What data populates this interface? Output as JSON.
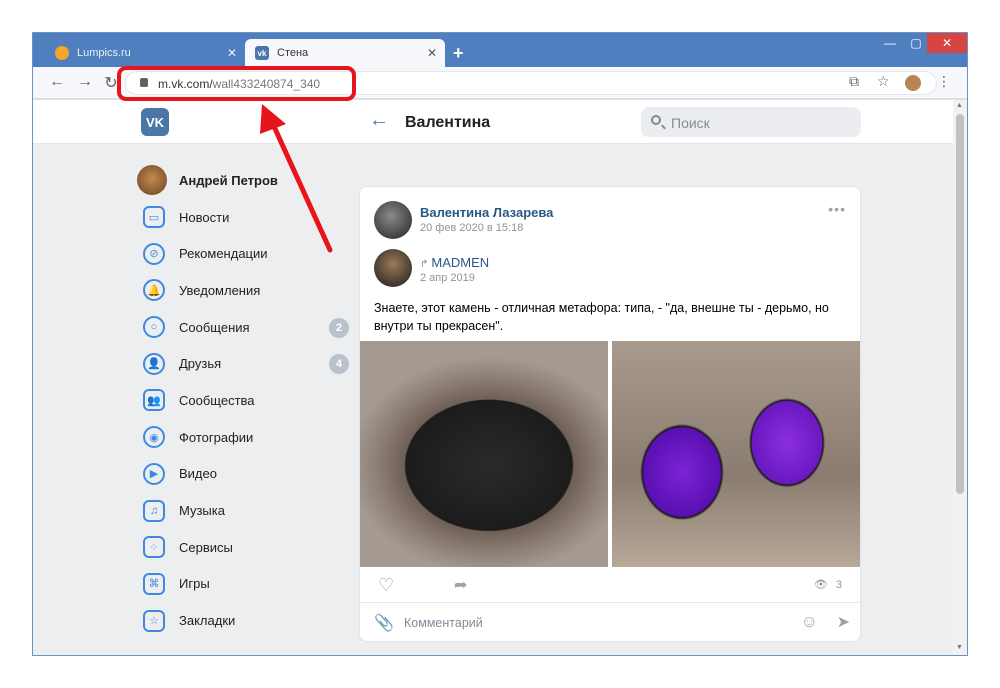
{
  "browser": {
    "tabs": [
      {
        "title": "Lumpics.ru",
        "active": false,
        "favicon_color": "#f4a62a"
      },
      {
        "title": "Стена",
        "active": true,
        "favicon_color": "#4a76a8"
      }
    ],
    "new_tab_label": "+",
    "url_host": "m.vk.com/",
    "url_path": "wall433240874_340"
  },
  "vk": {
    "logo": "VK",
    "page_title": "Валентина",
    "search_placeholder": "Поиск"
  },
  "sidebar": {
    "profile_name": "Андрей Петров",
    "items": [
      {
        "label": "Новости",
        "icon": "news-icon",
        "glyph": "▭",
        "badge": ""
      },
      {
        "label": "Рекомендации",
        "icon": "compass-icon",
        "glyph": "⊘",
        "badge": ""
      },
      {
        "label": "Уведомления",
        "icon": "bell-icon",
        "glyph": "🔔",
        "badge": ""
      },
      {
        "label": "Сообщения",
        "icon": "message-icon",
        "glyph": "○",
        "badge": "2"
      },
      {
        "label": "Друзья",
        "icon": "friends-icon",
        "glyph": "👤",
        "badge": "4"
      },
      {
        "label": "Сообщества",
        "icon": "communities-icon",
        "glyph": "👥",
        "badge": ""
      },
      {
        "label": "Фотографии",
        "icon": "camera-icon",
        "glyph": "◉",
        "badge": ""
      },
      {
        "label": "Видео",
        "icon": "video-icon",
        "glyph": "▶",
        "badge": ""
      },
      {
        "label": "Музыка",
        "icon": "music-icon",
        "glyph": "♫",
        "badge": ""
      },
      {
        "label": "Сервисы",
        "icon": "services-icon",
        "glyph": "⁘",
        "badge": ""
      },
      {
        "label": "Игры",
        "icon": "gamepad-icon",
        "glyph": "⌘",
        "badge": ""
      },
      {
        "label": "Закладки",
        "icon": "star-icon",
        "glyph": "☆",
        "badge": ""
      }
    ]
  },
  "post": {
    "author": "Валентина Лазарева",
    "date": "20 фев 2020 в 15:18",
    "repost_author": "MADMEN",
    "repost_date": "2 апр 2019",
    "text": "Знаете, этот камень - отличная метафора: типа, - \"да, внешне ты - дерьмо, но внутри ты прекрасен\".",
    "views": "3",
    "comment_placeholder": "Комментарий"
  },
  "colors": {
    "vk_blue": "#4a76a8",
    "link": "#2a5885",
    "highlight": "#e8141b"
  }
}
